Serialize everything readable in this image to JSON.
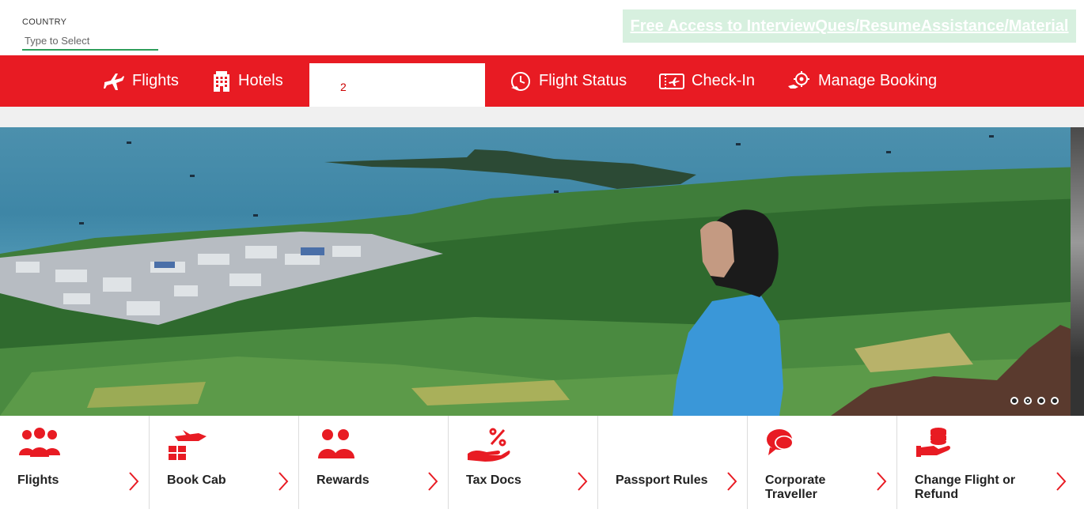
{
  "country": {
    "label": "COUNTRY",
    "placeholder": "Type to Select"
  },
  "promo": {
    "text": "Free Access to InterviewQues/ResumeAssistance/Material"
  },
  "nav": {
    "items": [
      {
        "label": "Flights",
        "icon": "plane-icon"
      },
      {
        "label": "Hotels",
        "icon": "building-icon"
      },
      {
        "label": "Flight Status",
        "icon": "clock-plane-icon"
      },
      {
        "label": "Check-In",
        "icon": "ticket-icon"
      },
      {
        "label": "Manage Booking",
        "icon": "gear-hand-icon"
      }
    ],
    "blank_field_text": "2"
  },
  "carousel": {
    "slides": 4,
    "active_index": 1
  },
  "tiles": [
    {
      "label": "Flights",
      "icon": "group-people-icon"
    },
    {
      "label": "Book Cab",
      "icon": "plane-car-icon"
    },
    {
      "label": "Rewards",
      "icon": "two-people-icon"
    },
    {
      "label": "Tax Docs",
      "icon": "percent-hand-icon"
    },
    {
      "label": "Passport Rules",
      "icon": ""
    },
    {
      "label": "Corporate Traveller",
      "icon": "chat-bubbles-icon"
    },
    {
      "label": "Change Flight or Refund",
      "icon": "coins-hand-icon"
    }
  ],
  "colors": {
    "brand_red": "#e81b23",
    "promo_bg": "#d7f0df",
    "input_underline": "#2e9e5b"
  }
}
